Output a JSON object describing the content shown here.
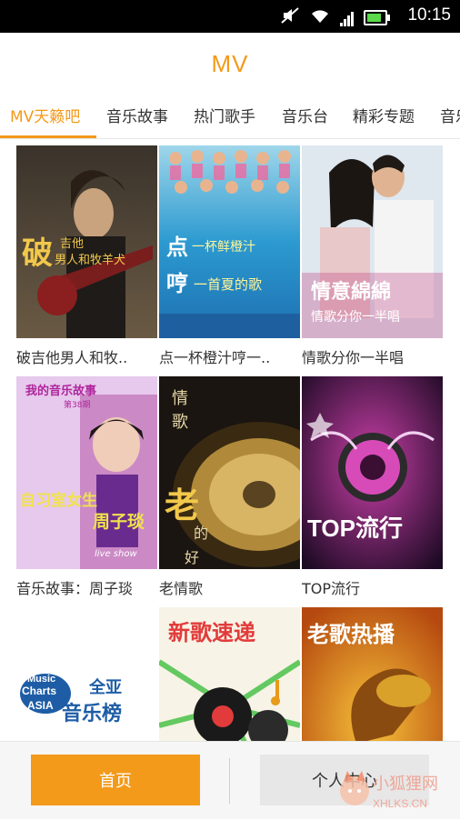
{
  "status_bar": {
    "time": "10:15",
    "icons": [
      "mute-icon",
      "wifi-icon",
      "signal-icon",
      "battery-icon"
    ],
    "battery_level": 0.7
  },
  "header": {
    "title": "MV"
  },
  "tabs": [
    {
      "label": "MV天籁吧",
      "active": true
    },
    {
      "label": "音乐故事",
      "active": false
    },
    {
      "label": "热门歌手",
      "active": false
    },
    {
      "label": "音乐台",
      "active": false
    },
    {
      "label": "精彩专题",
      "active": false
    },
    {
      "label": "音乐",
      "active": false
    }
  ],
  "items": [
    {
      "caption": "破吉他男人和牧..",
      "art_text": [
        "破",
        "吉他",
        "男人和牧羊犬"
      ]
    },
    {
      "caption": "点一杯橙汁哼一..",
      "art_text": [
        "点",
        "一杯鲜橙汁",
        "哼",
        "一首夏的歌"
      ]
    },
    {
      "caption": "情歌分你一半唱",
      "art_text": [
        "情意綿綿",
        "情歌分你一半唱"
      ]
    },
    {
      "caption": "音乐故事：周子琰",
      "art_text": [
        "我的音乐故事",
        "第38期",
        "自习室女生",
        "周子琰",
        "live show"
      ]
    },
    {
      "caption": "老情歌",
      "art_text": [
        "情",
        "歌",
        "老",
        "的",
        "好"
      ]
    },
    {
      "caption": "TOP流行",
      "art_text": [
        "TOP流行"
      ]
    },
    {
      "caption": "",
      "art_text": [
        "Music",
        "Charts",
        "ASIA",
        "全亚",
        "音乐榜"
      ]
    },
    {
      "caption": "",
      "art_text": [
        "新歌速递"
      ]
    },
    {
      "caption": "",
      "art_text": [
        "老歌热播"
      ]
    }
  ],
  "bottom_nav": {
    "home_label": "首页",
    "profile_label": "个人中心"
  },
  "watermark": {
    "text": "小狐狸网",
    "sub": "XHLKS.CN"
  },
  "colors": {
    "accent": "#f39a1a",
    "text": "#333333"
  }
}
